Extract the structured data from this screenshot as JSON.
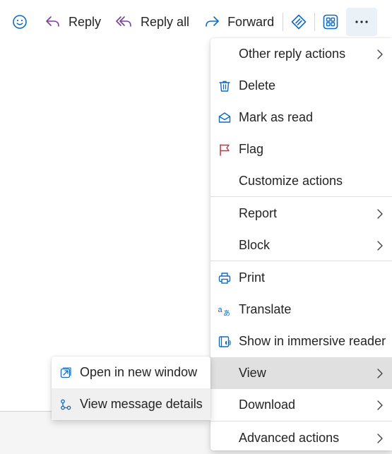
{
  "toolbar": {
    "reply_label": "Reply",
    "reply_all_label": "Reply all",
    "forward_label": "Forward"
  },
  "menu": {
    "items": [
      {
        "label": "Other reply actions",
        "icon": "none",
        "submenu": true
      },
      {
        "label": "Delete",
        "icon": "trash-icon",
        "submenu": false
      },
      {
        "label": "Mark as read",
        "icon": "envelope-open-icon",
        "submenu": false
      },
      {
        "label": "Flag",
        "icon": "flag-icon",
        "submenu": false
      },
      {
        "label": "Customize actions",
        "icon": "none",
        "submenu": false
      },
      {
        "label": "Report",
        "icon": "none",
        "submenu": true
      },
      {
        "label": "Block",
        "icon": "none",
        "submenu": true
      },
      {
        "label": "Print",
        "icon": "printer-icon",
        "submenu": false
      },
      {
        "label": "Translate",
        "icon": "translate-icon",
        "submenu": false
      },
      {
        "label": "Show in immersive reader",
        "icon": "immersive-reader-icon",
        "submenu": false
      },
      {
        "label": "View",
        "icon": "none",
        "submenu": true,
        "active": true
      },
      {
        "label": "Download",
        "icon": "none",
        "submenu": true
      },
      {
        "label": "Advanced actions",
        "icon": "none",
        "submenu": true
      }
    ]
  },
  "view_submenu": {
    "items": [
      {
        "label": "Open in new window",
        "icon": "open-new-window-icon"
      },
      {
        "label": "View message details",
        "icon": "message-details-icon"
      }
    ]
  },
  "colors": {
    "accent_blue": "#0f6cbd",
    "accent_purple": "#7a3f99",
    "flag_red": "#c4314b",
    "active_bg": "#e0e0e0"
  }
}
